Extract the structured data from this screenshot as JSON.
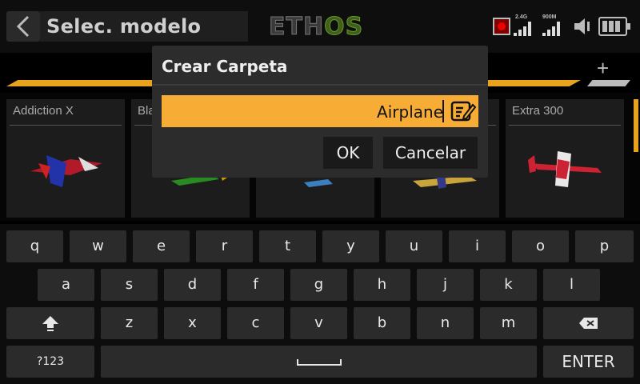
{
  "header": {
    "title": "Selec. modelo",
    "logo_left": "ETH",
    "logo_right": "OS",
    "rx_label_1": "2.4G",
    "rx_label_2": "900M"
  },
  "models": [
    {
      "name": "Addiction X"
    },
    {
      "name": "Bla"
    },
    {
      "name": ""
    },
    {
      "name": ""
    },
    {
      "name": "Extra 300"
    }
  ],
  "dialog": {
    "title": "Crear Carpeta",
    "input_value": "Airplane",
    "ok_label": "OK",
    "cancel_label": "Cancelar"
  },
  "keyboard": {
    "row1": [
      "q",
      "w",
      "e",
      "r",
      "t",
      "y",
      "u",
      "i",
      "o",
      "p"
    ],
    "row2": [
      "a",
      "s",
      "d",
      "f",
      "g",
      "h",
      "j",
      "k",
      "l"
    ],
    "row3": [
      "z",
      "x",
      "c",
      "v",
      "b",
      "n",
      "m"
    ],
    "symbols_label": "?123",
    "enter_label": "ENTER"
  },
  "colors": {
    "accent": "#f6ac35",
    "category_line": "#e8a21c",
    "background": "#000000",
    "key": "#2b2b2b"
  },
  "icons": [
    "back-icon",
    "record-icon",
    "signal-icon",
    "speaker-icon",
    "battery-icon",
    "plus-icon",
    "edit-icon",
    "shift-icon",
    "backspace-icon",
    "space-icon"
  ]
}
